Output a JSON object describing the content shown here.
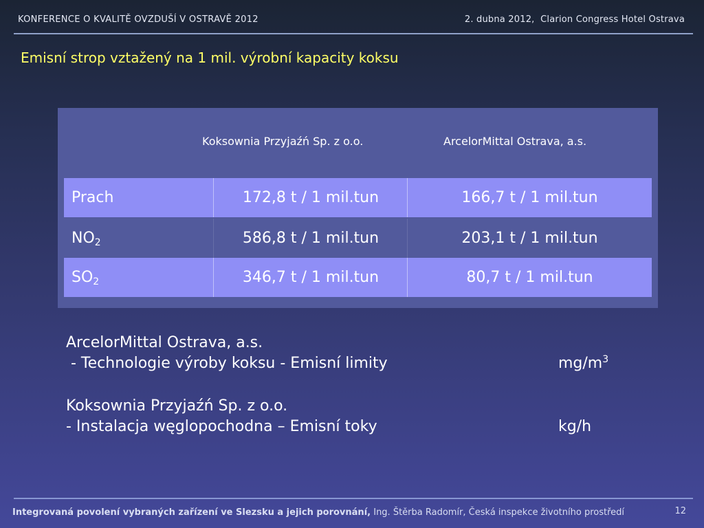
{
  "header": {
    "conference": "KONFERENCE O KVALITĚ OVZDUŠÍ V OSTRAVĚ 2012",
    "date_venue": "2. dubna 2012,  Clarion Congress Hotel Ostrava"
  },
  "slide_title": "Emisní strop vztažený na 1 mil. výrobní kapacity koksu",
  "table": {
    "columns": [
      "",
      "Koksownia Przyjaźń Sp. z o.o.",
      "ArcelorMittal Ostrava, a.s."
    ],
    "rows": [
      {
        "pollutant": "Prach",
        "subscript": "",
        "koksownia": "172,8 t / 1 mil.tun",
        "arcelor": "166,7 t / 1 mil.tun"
      },
      {
        "pollutant": "NO",
        "subscript": "2",
        "koksownia": "586,8 t / 1 mil.tun",
        "arcelor": "203,1 t / 1 mil.tun"
      },
      {
        "pollutant": "SO",
        "subscript": "2",
        "koksownia": "346,7 t / 1 mil.tun",
        "arcelor": "80,7 t / 1 mil.tun"
      }
    ]
  },
  "notes": [
    {
      "company": "ArcelorMittal Ostrava, a.s.",
      "detail": " - Technologie výroby koksu - Emisní limity",
      "unit": "mg/m",
      "unit_superscript": "3"
    },
    {
      "company": "Koksownia Przyjaźń Sp. z o.o.",
      "detail": "- Instalacja węglopochodna – Emisní toky",
      "unit": "kg/h",
      "unit_superscript": ""
    }
  ],
  "footer": {
    "subject": "Integrovaná povolení vybraných zařízení ve Slezsku a jejich porovnání,",
    "author": "Ing. Štěrba  Radomír, Česká inspekce životního prostředí",
    "page_number": "12"
  }
}
